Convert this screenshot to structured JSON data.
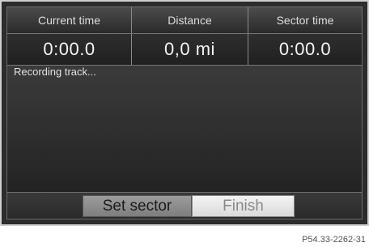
{
  "header": {
    "current_time_label": "Current time",
    "distance_label": "Distance",
    "sector_time_label": "Sector time"
  },
  "values": {
    "current_time": "0:00.0",
    "distance": "0,0 mi",
    "sector_time": "0:00.0"
  },
  "status_text": "Recording track...",
  "buttons": {
    "set_sector": "Set sector",
    "finish": "Finish"
  },
  "reference_code": "P54.33-2262-31"
}
